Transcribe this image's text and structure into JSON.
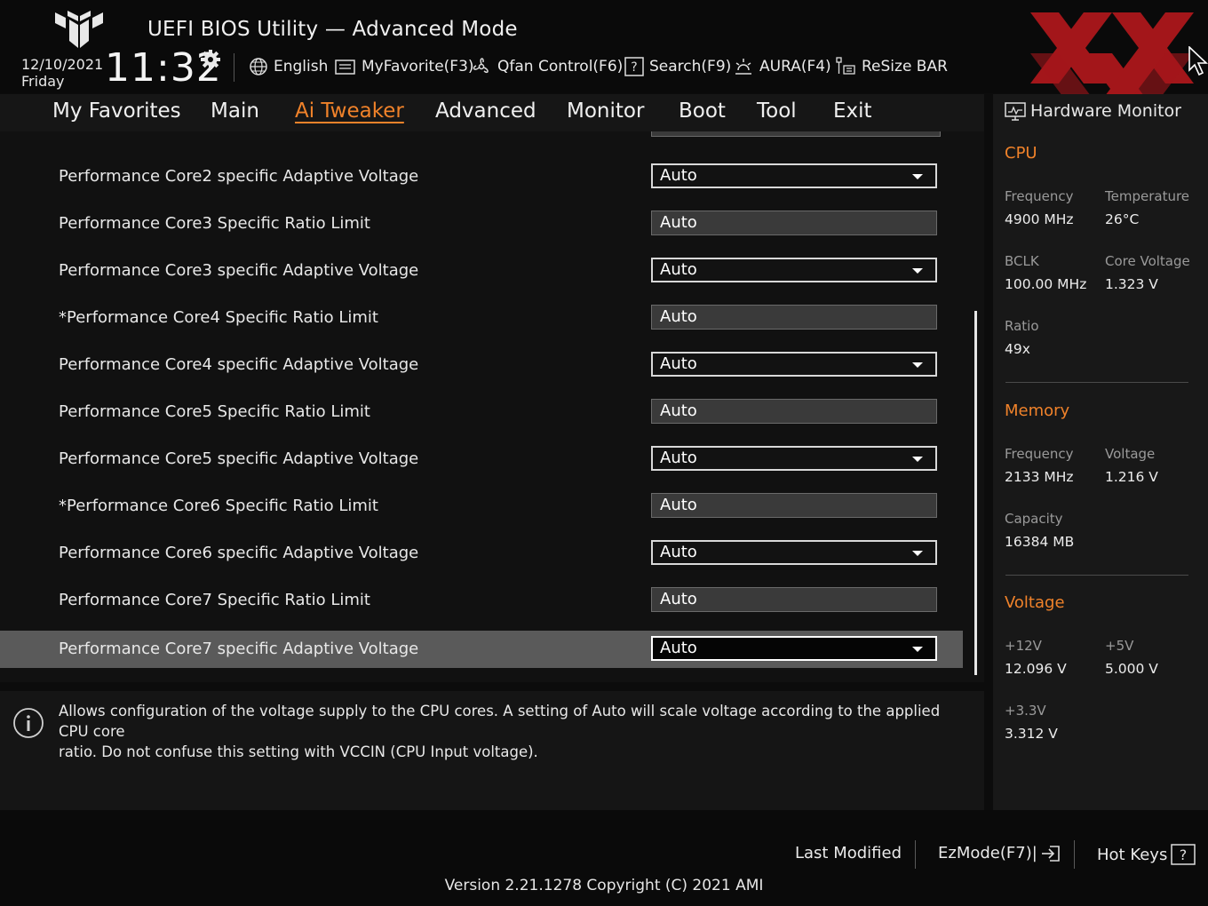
{
  "header": {
    "title": "UEFI BIOS Utility — Advanced Mode",
    "date": "12/10/2021",
    "day": "Friday",
    "time": "11:32",
    "toolbar": [
      {
        "label": "English",
        "icon": "globe-icon"
      },
      {
        "label": "MyFavorite(F3)",
        "icon": "favorite-icon"
      },
      {
        "label": "Qfan Control(F6)",
        "icon": "fan-icon"
      },
      {
        "label": "Search(F9)",
        "icon": "search-help-icon"
      },
      {
        "label": "AURA(F4)",
        "icon": "aura-icon"
      },
      {
        "label": "ReSize BAR",
        "icon": "resize-bar-icon"
      }
    ]
  },
  "nav": {
    "tabs": [
      "My Favorites",
      "Main",
      "Ai Tweaker",
      "Advanced",
      "Monitor",
      "Boot",
      "Tool",
      "Exit"
    ],
    "active": "Ai Tweaker"
  },
  "settings": [
    {
      "label": "Performance Core2 specific Adaptive Voltage",
      "value": "Auto",
      "type": "dropdown"
    },
    {
      "label": "Performance Core3 Specific Ratio Limit",
      "value": "Auto",
      "type": "text"
    },
    {
      "label": "Performance Core3 specific Adaptive Voltage",
      "value": "Auto",
      "type": "dropdown"
    },
    {
      "label": "*Performance Core4 Specific Ratio Limit",
      "value": "Auto",
      "type": "text"
    },
    {
      "label": "Performance Core4 specific Adaptive Voltage",
      "value": "Auto",
      "type": "dropdown"
    },
    {
      "label": "Performance Core5 Specific Ratio Limit",
      "value": "Auto",
      "type": "text"
    },
    {
      "label": "Performance Core5 specific Adaptive Voltage",
      "value": "Auto",
      "type": "dropdown"
    },
    {
      "label": "*Performance Core6 Specific Ratio Limit",
      "value": "Auto",
      "type": "text"
    },
    {
      "label": "Performance Core6 specific Adaptive Voltage",
      "value": "Auto",
      "type": "dropdown"
    },
    {
      "label": "Performance Core7 Specific Ratio Limit",
      "value": "Auto",
      "type": "text"
    },
    {
      "label": "Performance Core7 specific Adaptive Voltage",
      "value": "Auto",
      "type": "dropdown",
      "selected": true
    }
  ],
  "help": {
    "line1": "Allows configuration of the voltage supply to the CPU cores. A setting of Auto will scale voltage according to the applied CPU core",
    "line2": "ratio.  Do not confuse this setting with VCCIN (CPU Input voltage)."
  },
  "hardware_monitor": {
    "title": "Hardware Monitor",
    "cpu": {
      "heading": "CPU",
      "frequency_label": "Frequency",
      "frequency": "4900 MHz",
      "temperature_label": "Temperature",
      "temperature": "26°C",
      "bclk_label": "BCLK",
      "bclk": "100.00 MHz",
      "core_voltage_label": "Core Voltage",
      "core_voltage": "1.323 V",
      "ratio_label": "Ratio",
      "ratio": "49x"
    },
    "memory": {
      "heading": "Memory",
      "frequency_label": "Frequency",
      "frequency": "2133 MHz",
      "voltage_label": "Voltage",
      "voltage": "1.216 V",
      "capacity_label": "Capacity",
      "capacity": "16384 MB"
    },
    "voltage": {
      "heading": "Voltage",
      "v12_label": "+12V",
      "v12": "12.096 V",
      "v5_label": "+5V",
      "v5": "5.000 V",
      "v33_label": "+3.3V",
      "v33": "3.312 V"
    }
  },
  "footer": {
    "last_modified": "Last Modified",
    "ezmode": "EzMode(F7)|",
    "hot_keys": "Hot Keys",
    "version": "Version 2.21.1278 Copyright (C) 2021 AMI"
  },
  "colors": {
    "accent": "#f0822a",
    "background": "#0c0c0c",
    "selected_row": "#5a5a5a",
    "watermark": "#b0181c"
  }
}
